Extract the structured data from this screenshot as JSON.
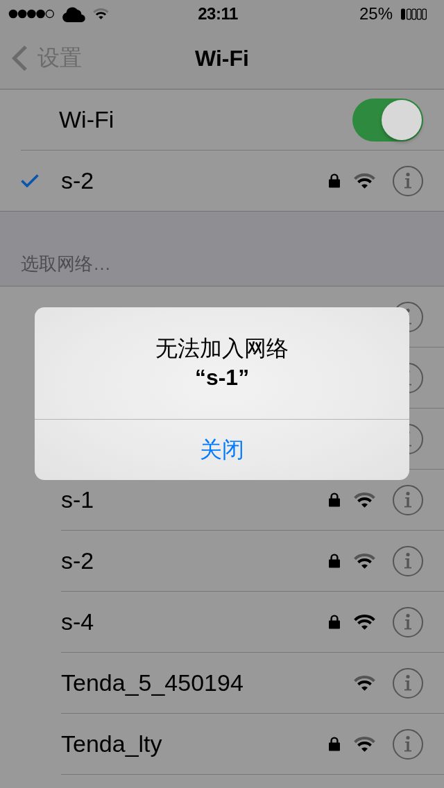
{
  "status_bar": {
    "time": "23:11",
    "battery": "25%"
  },
  "nav_bar": {
    "back": "设置",
    "title": "Wi-Fi"
  },
  "wifi_toggle": {
    "label": "Wi-Fi",
    "on": true
  },
  "current_network": {
    "name": "s-2",
    "connected": true,
    "secured": true,
    "full_signal": false
  },
  "section_header": "选取网络…",
  "networks": [
    {
      "kind": "covered"
    },
    {
      "kind": "covered"
    },
    {
      "kind": "covered"
    },
    {
      "kind": "network",
      "name": "s-1",
      "secured": true,
      "full_signal": false
    },
    {
      "kind": "network",
      "name": "s-2",
      "secured": true,
      "full_signal": false
    },
    {
      "kind": "network",
      "name": "s-4",
      "secured": true,
      "full_signal": true
    },
    {
      "kind": "network",
      "name": "Tenda_5_450194",
      "secured": false,
      "full_signal": false
    },
    {
      "kind": "network",
      "name": "Tenda_lty",
      "secured": true,
      "full_signal": false
    }
  ],
  "alert": {
    "title": "无法加入网络",
    "subtitle": "“s-1”",
    "button": "关闭"
  }
}
